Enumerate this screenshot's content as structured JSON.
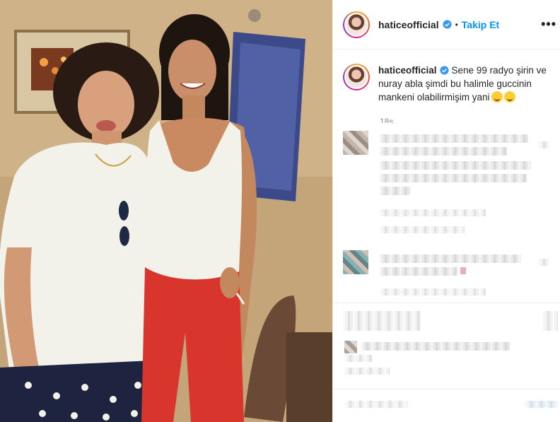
{
  "post": {
    "photo_alt": ""
  },
  "header": {
    "username": "haticeofficial",
    "separator": "•",
    "follow_label": "Takip Et",
    "more_label": "•••"
  },
  "caption": {
    "username": "haticeofficial",
    "text": "Sene 99 radyo şirin ve nuray abla şimdi bu halimle guccinin mankeni olabilirmişim yani",
    "emojis": [
      "flushed-face-emoji",
      "grinning-face-emoji"
    ],
    "time": "18s"
  },
  "colors": {
    "follow": "#0095f6",
    "verified": "#3897f0",
    "border": "#efefef",
    "muted": "#8e8e8e"
  }
}
